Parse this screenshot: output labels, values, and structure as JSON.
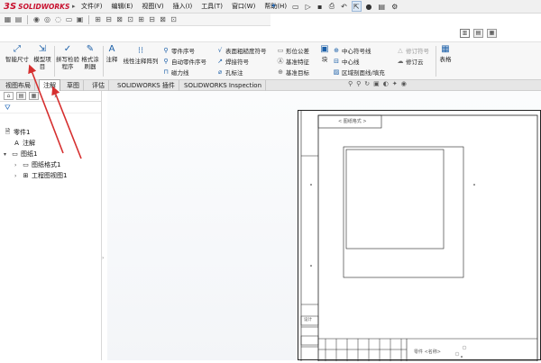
{
  "app": {
    "brand": "SOLIDWORKS",
    "brand_mark": "3S",
    "menu": [
      "文件(F)",
      "编辑(E)",
      "视图(V)",
      "插入(I)",
      "工具(T)",
      "窗口(W)",
      "帮助(H)"
    ]
  },
  "ribbon": {
    "smart_dimension": "智能尺寸",
    "model_items": "模型项目",
    "spell_check": "拼写检验程序",
    "format_painter": "格式涂刷器",
    "note": "注释",
    "linear_note_pattern": "线性注释阵列",
    "balloon": "零件序号",
    "auto_balloon": "自动零件序号",
    "magnetic_line": "磁力线",
    "surface_finish": "表面粗糙度符号",
    "weld_symbol": "焊接符号",
    "hole_callout": "孔标注",
    "geometric_tolerance": "形位公差",
    "datum_feature": "基准特征",
    "datum_target": "基准目标",
    "block": "块",
    "center_mark": "中心符号线",
    "centerline": "中心线",
    "area_hatch": "区域剖面线/填充",
    "revision_symbol": "修订符号",
    "revision_cloud": "修订云",
    "tables": "表格"
  },
  "tabs": [
    "视图布局",
    "注解",
    "草图",
    "评估",
    "SOLIDWORKS 插件",
    "SOLIDWORKS Inspection"
  ],
  "active_tab": "注解",
  "tree": {
    "root": "零件1",
    "annotations": "注解",
    "sheet": "图纸1",
    "sheet_format": "图纸格式1",
    "drawing_view": "工程图视图1"
  },
  "sheet_marks": {
    "title_tag": "< 图纸格式 >",
    "rev_label": "设计",
    "part_label": "零件 <名称>"
  },
  "colors": {
    "brand": "#c8102e",
    "annotation_arrow": "#d62f2f",
    "accent": "#1b5fa8"
  }
}
